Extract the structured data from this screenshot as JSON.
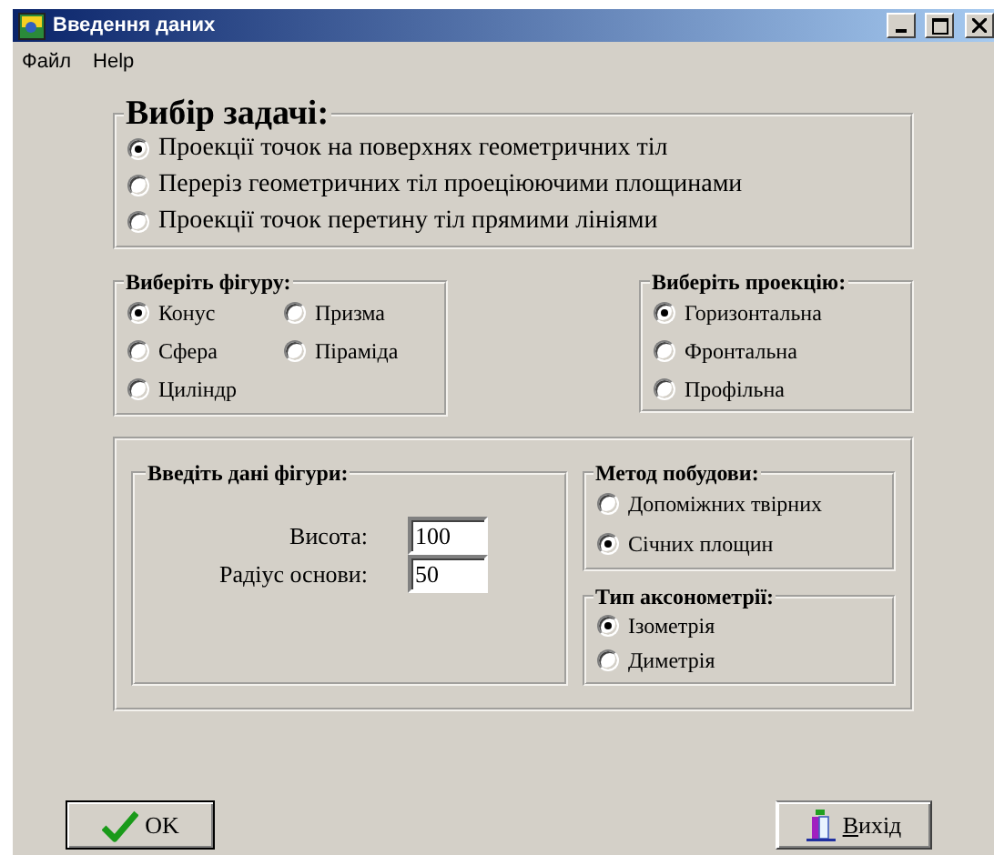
{
  "window": {
    "title": "Введення даних"
  },
  "menu": [
    "Файл",
    "Help"
  ],
  "task_group": {
    "title": "Вибір задачі:",
    "options": [
      {
        "label": "Проекції точок на поверхнях геометричних тіл",
        "selected": true
      },
      {
        "label": "Переріз геометричних тіл проеціюючими площинами",
        "selected": false
      },
      {
        "label": "Проекції точок перетину тіл прямими лініями",
        "selected": false
      }
    ]
  },
  "figure_group": {
    "title": "Виберіть фігуру:",
    "options": [
      {
        "label": "Конус",
        "selected": true
      },
      {
        "label": "Призма",
        "selected": false
      },
      {
        "label": "Сфера",
        "selected": false
      },
      {
        "label": "Піраміда",
        "selected": false
      },
      {
        "label": "Циліндр",
        "selected": false
      }
    ]
  },
  "projection_group": {
    "title": "Виберіть проекцію:",
    "options": [
      {
        "label": "Горизонтальна",
        "selected": true
      },
      {
        "label": "Фронтальна",
        "selected": false
      },
      {
        "label": "Профільна",
        "selected": false
      }
    ]
  },
  "figure_data": {
    "title": "Введіть дані фігури:",
    "fields": [
      {
        "label": "Висота:",
        "value": "100"
      },
      {
        "label": "Радіус основи:",
        "value": "50"
      }
    ]
  },
  "method_group": {
    "title": "Метод побудови:",
    "options": [
      {
        "label": "Допоміжних твірних",
        "selected": false
      },
      {
        "label": "Січних площин",
        "selected": true
      }
    ]
  },
  "axonometry_group": {
    "title": "Тип аксонометрії:",
    "options": [
      {
        "label": "Ізометрія",
        "selected": true
      },
      {
        "label": "Диметрія",
        "selected": false
      }
    ]
  },
  "buttons": [
    {
      "label": "OK",
      "kind": "ok"
    },
    {
      "label": "Вихід",
      "kind": "exit"
    }
  ]
}
